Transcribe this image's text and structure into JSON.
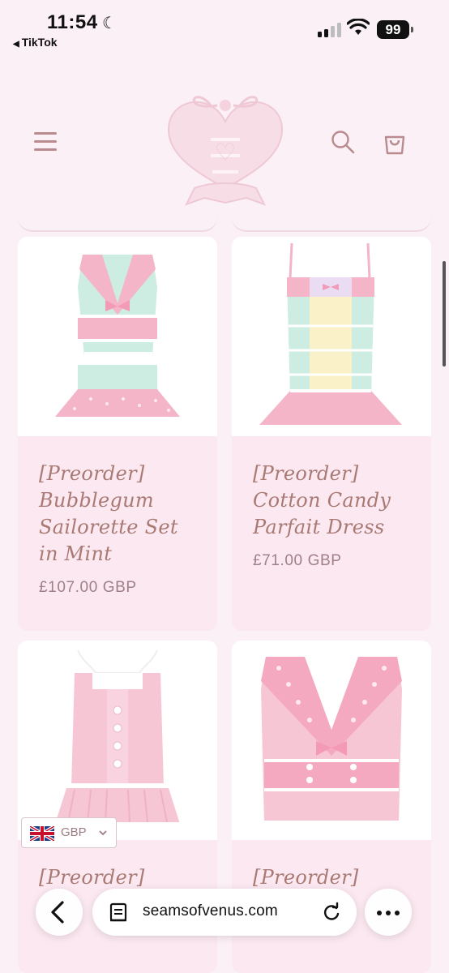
{
  "status_bar": {
    "time": "11:54",
    "back_app": "TikTok",
    "battery": "99"
  },
  "header": {
    "menu_icon": "hamburger-icon",
    "logo": "seams-of-venus-heart-logo",
    "search_icon": "search-icon",
    "cart_icon": "cart-icon"
  },
  "products": [
    {
      "title": "[Preorder] Bubblegum Sailorette Set in Mint",
      "price": "£107.00 GBP"
    },
    {
      "title": "[Preorder] Cotton Candy Parfait Dress",
      "price": "£71.00 GBP"
    },
    {
      "title": "[Preorder]",
      "price": ""
    },
    {
      "title": "[Preorder]",
      "price": ""
    }
  ],
  "currency": {
    "code": "GBP",
    "flag": "uk-flag-icon"
  },
  "browser": {
    "url": "seamsofvenus.com"
  },
  "colors": {
    "page_bg": "#fbf0f5",
    "card_bg": "#fbe8f0",
    "title_text": "#a97a74",
    "price_text": "#a08088",
    "icon_color": "#b98b8f"
  }
}
